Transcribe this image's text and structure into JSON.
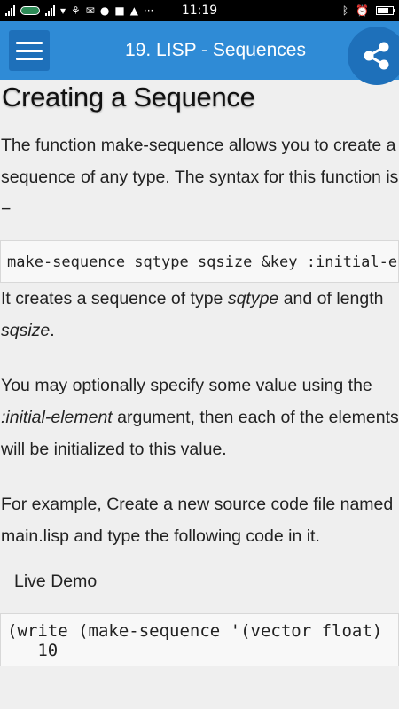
{
  "status_bar": {
    "time": "11:19",
    "battery_level": 0.75,
    "left_icons": [
      "signal-icon",
      "carrier-logo-icon",
      "signal-icon",
      "wifi-icon",
      "nfc-icon",
      "gmail-icon",
      "messenger-icon",
      "facebook-icon",
      "cat-icon",
      "more-icon"
    ],
    "right_icons": [
      "bluetooth-icon",
      "alarm-icon",
      "battery-icon"
    ]
  },
  "app_bar": {
    "title": "19. LISP - Sequences",
    "color": "#2f8bd6",
    "button_color": "#1e70ba"
  },
  "article": {
    "heading": "Creating a Sequence",
    "p1": "The function make-sequence allows you to create a sequence of any type. The syntax for this function is −",
    "code_syntax": "make-sequence sqtype sqsize &key :initial-element",
    "p2": {
      "t1": "It creates a sequence of type ",
      "em1": "sqtype",
      "t2": " and of length ",
      "em2": "sqsize",
      "t3": "."
    },
    "p3": {
      "t1": "You may optionally specify some value using the ",
      "em1": ":initial-element",
      "t2": " argument, then each of the elements will be initialized to this value."
    },
    "p4": "For example, Create a new source code file named main.lisp and type the following code in it.",
    "live_demo": {
      "glyph": "",
      "label": "Live Demo"
    },
    "code_example": {
      "line1": "(write (make-sequence '(vector float)",
      "line2": "   10"
    }
  }
}
